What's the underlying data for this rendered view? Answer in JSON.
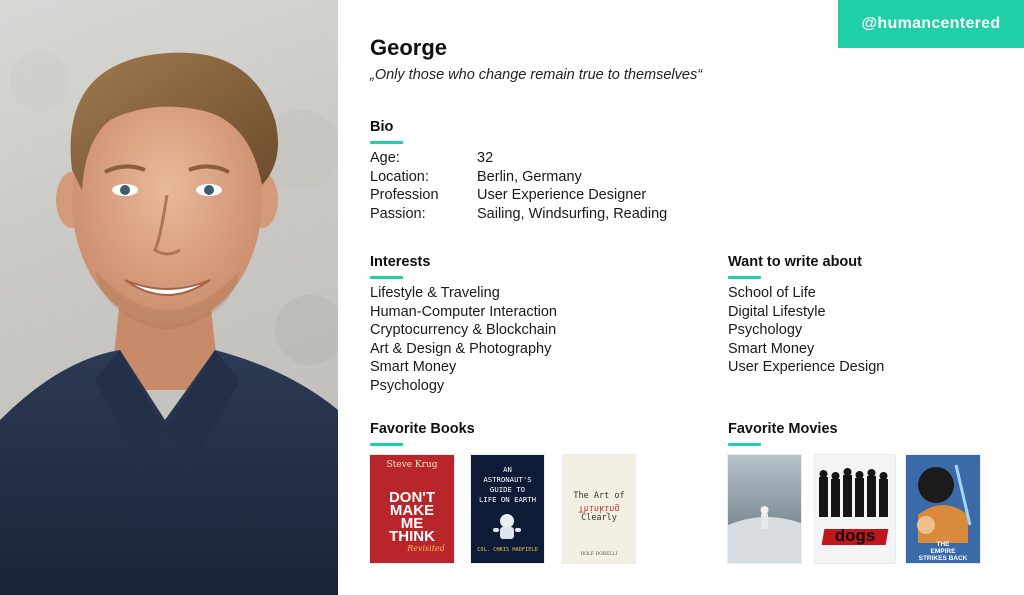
{
  "accent_color": "#1ecfa8",
  "badge": {
    "label": "@humancentered"
  },
  "profile": {
    "name": "George",
    "quote": "„Only those who change remain true to themselves“"
  },
  "bio": {
    "title": "Bio",
    "rows": [
      {
        "key": "Age:",
        "value": "32"
      },
      {
        "key": "Location:",
        "value": "Berlin, Germany"
      },
      {
        "key": "Profession",
        "value": "User Experience Designer"
      },
      {
        "key": "Passion:",
        "value": "Sailing, Windsurfing, Reading"
      }
    ]
  },
  "interests": {
    "title": "Interests",
    "items": [
      "Lifestyle & Traveling",
      "Human-Computer Interaction",
      "Cryptocurrency & Blockchain",
      "Art & Design & Photography",
      "Smart Money",
      "Psychology"
    ]
  },
  "write_about": {
    "title": "Want to write about",
    "items": [
      "School of Life",
      "Digital Lifestyle",
      "Psychology",
      "Smart Money",
      "User Experience Design"
    ]
  },
  "books": {
    "title": "Favorite Books",
    "covers": [
      {
        "author": "Steve Krug",
        "title_lines": [
          "DON'T",
          "MAKE",
          "ME",
          "THINK"
        ],
        "tag": "Revisited",
        "bg": "#b8252a"
      },
      {
        "title_lines": [
          "AN",
          "ASTRONAUT'S",
          "GUIDE TO",
          "LIFE ON EARTH"
        ],
        "author": "COL. CHRIS HADFIELD",
        "bg": "#0d1b36"
      },
      {
        "title_lines": [
          "The Art of",
          "Thinking",
          "Clearly"
        ],
        "author": "ROLF DOBELLI",
        "bg": "#f1f0e2"
      }
    ]
  },
  "movies": {
    "title": "Favorite Movies",
    "covers": [
      {
        "name": "interstellar-poster",
        "bg": "#8a9aa4"
      },
      {
        "title_word": "dogs",
        "bg": "#f4f4f4"
      },
      {
        "title_lines": [
          "THE",
          "EMPIRE",
          "STRIKES BACK"
        ],
        "bg": "#3a6aa8"
      }
    ]
  }
}
